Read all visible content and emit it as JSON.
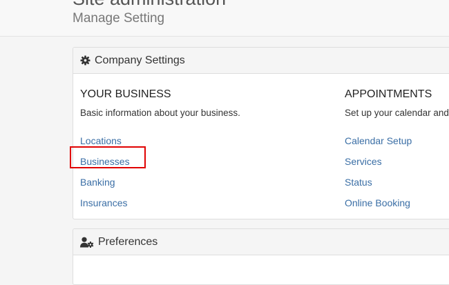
{
  "header": {
    "site_title": "Site administration",
    "page_title": "Manage Setting"
  },
  "company_panel": {
    "title": "Company Settings",
    "icon": "gear-icon",
    "business": {
      "heading": "YOUR BUSINESS",
      "description": "Basic information about your business.",
      "links": [
        "Locations",
        "Businesses",
        "Banking",
        "Insurances"
      ]
    },
    "appointments": {
      "heading": "APPOINTMENTS",
      "description": "Set up your calendar and",
      "links": [
        "Calendar Setup",
        "Services",
        "Status",
        "Online Booking"
      ]
    }
  },
  "preferences_panel": {
    "title": "Preferences",
    "icon": "user-gear-icon"
  },
  "colors": {
    "link": "#3a6ea5",
    "highlight": "#e00000",
    "panel_heading_bg": "#f5f5f5",
    "page_bg": "#f5f5f5"
  }
}
